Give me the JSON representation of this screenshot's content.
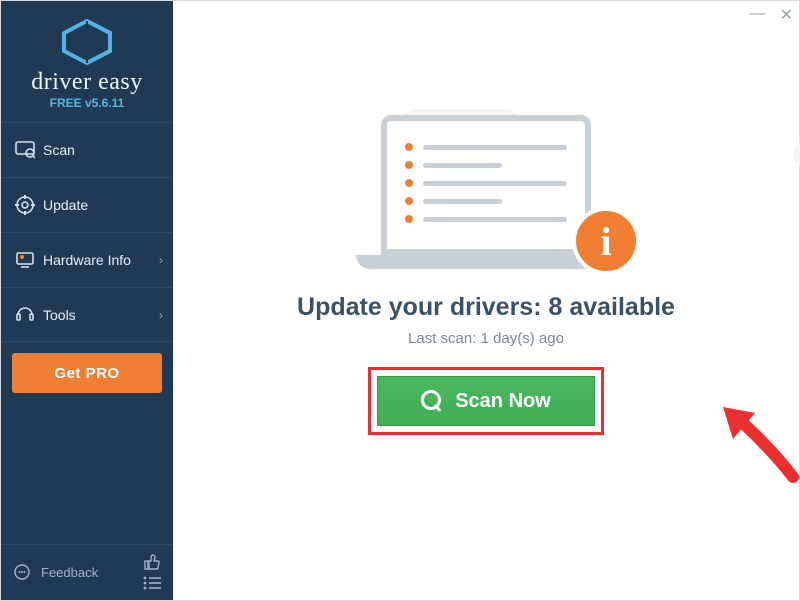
{
  "brand": {
    "name": "driver easy",
    "version": "FREE v5.6.11"
  },
  "sidebar": {
    "items": [
      {
        "label": "Scan",
        "icon": "scan-icon",
        "chevron": false
      },
      {
        "label": "Update",
        "icon": "update-icon",
        "chevron": false
      },
      {
        "label": "Hardware Info",
        "icon": "hardware-icon",
        "chevron": true
      },
      {
        "label": "Tools",
        "icon": "tools-icon",
        "chevron": true
      }
    ],
    "getpro": "Get PRO",
    "feedback": "Feedback"
  },
  "main": {
    "headline": "Update your drivers: 8 available",
    "subline": "Last scan: 1 day(s) ago",
    "scan_button": "Scan Now"
  }
}
